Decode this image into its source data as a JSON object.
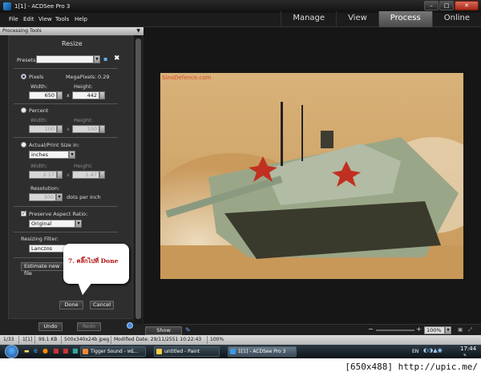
{
  "window": {
    "title": "1[1] - ACDSee Pro 3"
  },
  "menu": {
    "file": "File",
    "edit": "Edit",
    "view": "View",
    "tools": "Tools",
    "help": "Help"
  },
  "modes": {
    "manage": "Manage",
    "view": "View",
    "process": "Process",
    "online": "Online",
    "active": "Process"
  },
  "panel": {
    "header": "Processing Tools",
    "title": "Resize",
    "presets_label": "Presets",
    "presets_value": "",
    "pixels_label": "Pixels",
    "megapixels_label": "MegaPixels:",
    "megapixels_value": "0.29",
    "width_label": "Width:",
    "height_label": "Height:",
    "pixels_width": "650",
    "pixels_height": "442",
    "percent_label": "Percent",
    "percent_width": "100",
    "percent_height": "100",
    "actual_label": "Actual/Print Size in:",
    "units_value": "inches",
    "actual_width": "2.17",
    "actual_height": "1.47",
    "resolution_label": "Resolution:",
    "resolution_value": "300",
    "dpi_label": "dots per inch",
    "x": "x",
    "aspect_label": "Preserve Aspect Ratio:",
    "aspect_value": "Original",
    "filter_label": "Resizing Filter:",
    "filter_value": "Lanczos",
    "estimate_label": "Estimate new file",
    "done_label": "Done",
    "cancel_label": "Cancel",
    "undo_label": "Undo",
    "redo_label": "Redo"
  },
  "callout": {
    "text": "7. คลิ๊กไปที่ Done"
  },
  "image": {
    "watermark": "SinoDefence.com"
  },
  "viewer_bar": {
    "show_previous": "Show Previous",
    "zoom": "100%"
  },
  "status": {
    "index": "1/33",
    "name": "1[1]",
    "size": "99.1 KB",
    "info": "500x340x24b jpeg",
    "modified": "Modified Date: 29/11/2551 10:22:43",
    "zoom": "100%"
  },
  "taskbar": {
    "items": [
      "Tigger Sound - หน้...",
      "untitled - Paint",
      "1[1] - ACDSee Pro 3"
    ],
    "lang": "EN",
    "clock": "17:44",
    "clock_day": "จ."
  },
  "resolution_label": "[650x488] http://upic.me/"
}
